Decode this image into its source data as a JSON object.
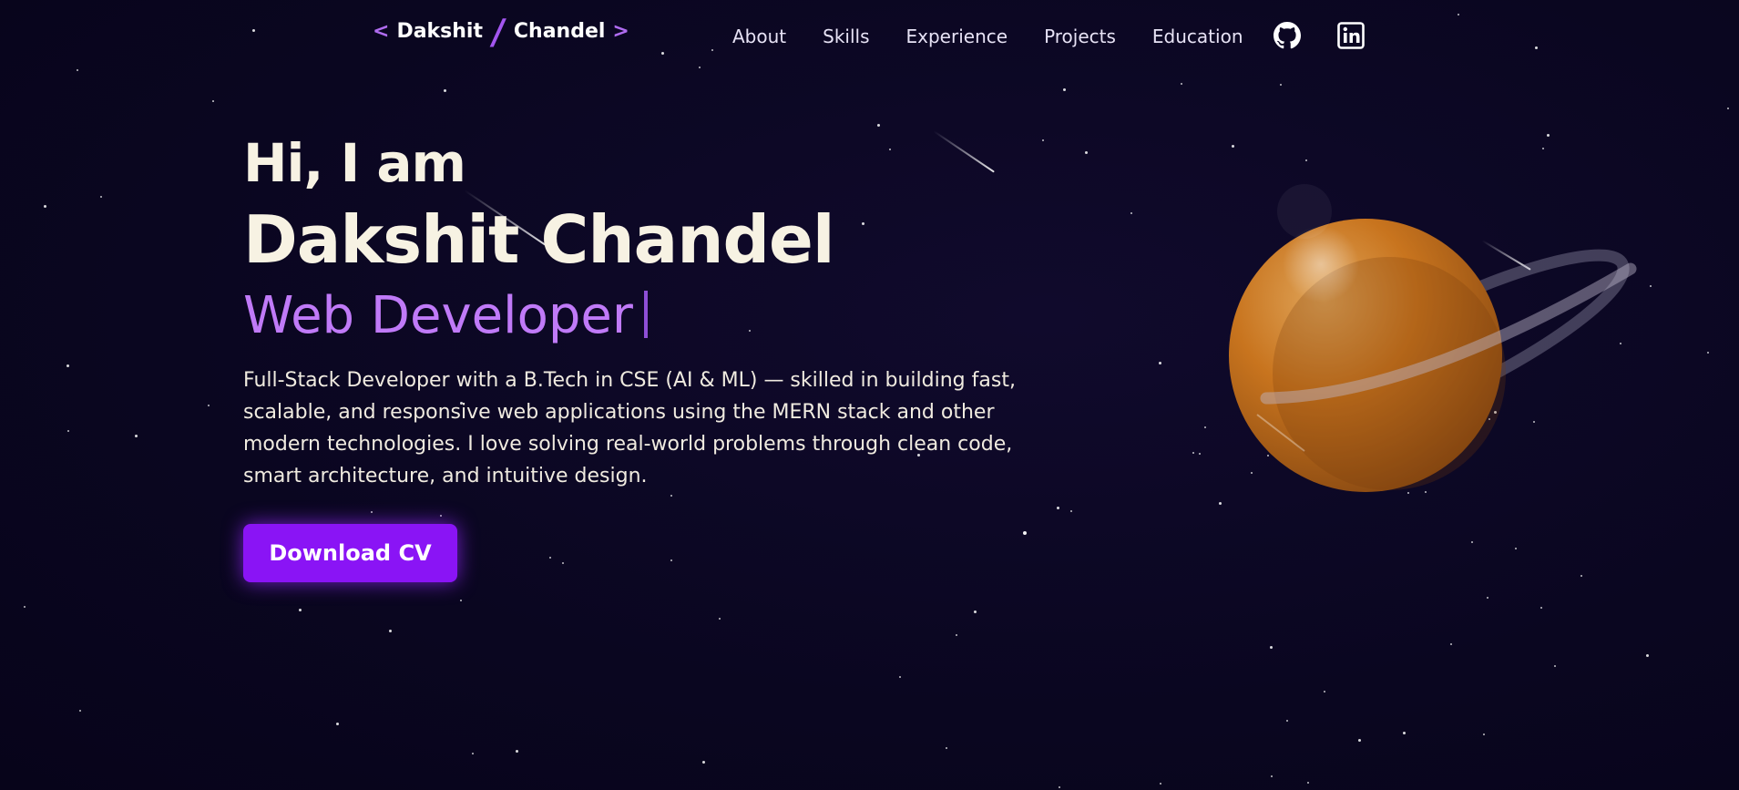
{
  "logo": {
    "left_bracket": "<",
    "first": "Dakshit",
    "slash": "/",
    "last": "Chandel",
    "right_bracket": ">"
  },
  "nav": {
    "items": [
      {
        "label": "About"
      },
      {
        "label": "Skills"
      },
      {
        "label": "Experience"
      },
      {
        "label": "Projects"
      },
      {
        "label": "Education"
      }
    ],
    "social": [
      {
        "icon": "github-icon"
      },
      {
        "icon": "linkedin-icon"
      }
    ]
  },
  "hero": {
    "greeting": "Hi, I am",
    "name": "Dakshit Chandel",
    "role": "Web Developer",
    "description": "Full-Stack Developer with a B.Tech in CSE (AI & ML) — skilled in building fast, scalable, and responsive web applications using the MERN stack and other modern technologies. I love solving real-world problems through clean code, smart architecture, and intuitive design.",
    "cta_label": "Download CV"
  },
  "colors": {
    "background": "#0a0620",
    "accent": "#8a14f5",
    "role_text": "#c07af8",
    "planet": "#c8741e"
  }
}
